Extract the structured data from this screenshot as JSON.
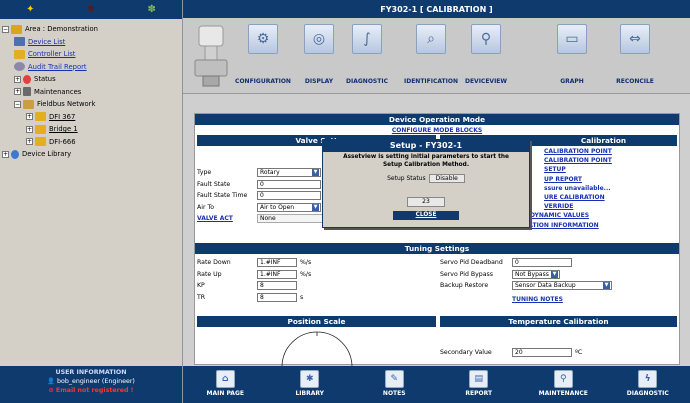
{
  "left": {
    "tree": [
      {
        "label": "Area : Demonstration",
        "link": false
      },
      {
        "label": "Device List",
        "link": true
      },
      {
        "label": "Controller List",
        "link": true
      },
      {
        "label": "Audit Trail Report",
        "link": true
      },
      {
        "label": "Status",
        "link": false
      },
      {
        "label": "Maintenances",
        "link": false
      },
      {
        "label": "Fieldbus Network",
        "link": false
      },
      {
        "label": "DFI 367",
        "link": true
      },
      {
        "label": "Bridge 1",
        "link": true
      },
      {
        "label": "DFI-666",
        "link": false
      },
      {
        "label": "Device Library",
        "link": false
      }
    ],
    "user": {
      "title": "USER INFORMATION",
      "name": "bob_engineer (Engineer)",
      "email": "Email not registered !"
    }
  },
  "main": {
    "title": "FY302-1 [ CALIBRATION ]",
    "toolbar": [
      "CONFIGURATION",
      "DISPLAY",
      "DIAGNOSTIC",
      "IDENTIFICATION",
      "DEVICEVIEW",
      "GRAPH",
      "RECONCILE"
    ],
    "mode_header": "Device Operation Mode",
    "mode_link": "CONFIGURE MODE BLOCKS",
    "valve": {
      "header": "Valve Sett",
      "fields": [
        {
          "label": "Type",
          "value": "Rotary",
          "kind": "select"
        },
        {
          "label": "Fault State",
          "value": "0",
          "unit": "%",
          "kind": "input"
        },
        {
          "label": "Fault State Time",
          "value": "0",
          "kind": "input"
        },
        {
          "label": "Air To",
          "value": "Air to Open",
          "kind": "select"
        }
      ],
      "act_link": "VALVE ACT",
      "act_value": "None"
    },
    "calibration": {
      "header": "Calibration",
      "links": [
        "CALIBRATION POINT",
        "CALIBRATION POINT",
        "SETUP",
        "UP REPORT",
        "ssure unavailable...",
        "URE CALIBRATION",
        "VERRIDE",
        "DYNAMIC VALUES",
        "CALIBRATION INFORMATION"
      ]
    },
    "tuning": {
      "header": "Tuning Settings",
      "left": [
        {
          "label": "Rate Down",
          "value": "1.#INF",
          "unit": "%/s"
        },
        {
          "label": "Rate Up",
          "value": "1.#INF",
          "unit": "%/s"
        },
        {
          "label": "KP",
          "value": "8",
          "unit": ""
        },
        {
          "label": "TR",
          "value": "8",
          "unit": "s"
        }
      ],
      "right": [
        {
          "label": "Servo Pid Deadband",
          "value": "0",
          "kind": "input"
        },
        {
          "label": "Servo Pid Bypass",
          "value": "Not Bypass",
          "kind": "select"
        },
        {
          "label": "Backup Restore",
          "value": "Sensor Data Backup",
          "kind": "select"
        }
      ],
      "notes_link": "TUNING NOTES"
    },
    "position_scale": "Position Scale",
    "temperature": {
      "header": "Temperature Calibration",
      "label": "Secondary Value",
      "value": "20",
      "unit": "ºC"
    }
  },
  "dialog": {
    "title": "Setup - FY302-1",
    "message": "Assetview is setting initial parameters to start the Setup Calibration Method.",
    "status_label": "Setup Status",
    "status_value": "Disable",
    "counter": "23",
    "close": "CLOSE"
  },
  "bottom": [
    "MAIN PAGE",
    "LIBRARY",
    "NOTES",
    "REPORT",
    "MAINTENANCE",
    "DIAGNOSTIC"
  ]
}
